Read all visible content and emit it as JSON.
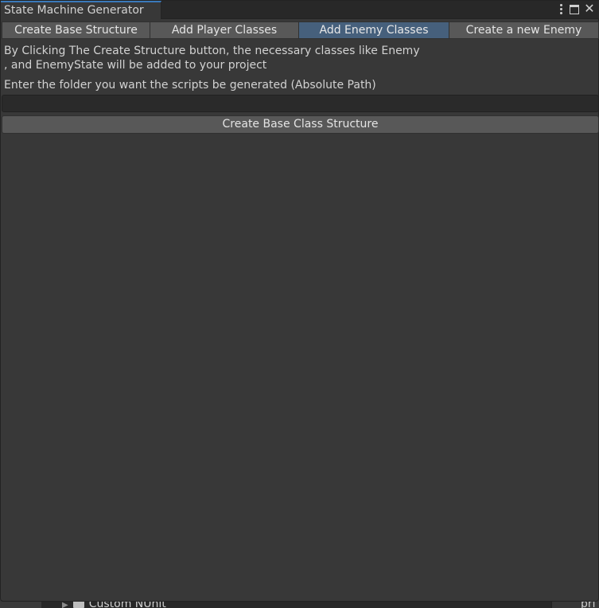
{
  "window": {
    "title": "State Machine Generator",
    "controls": {
      "menu_icon": "kebab-menu-icon",
      "maximize_icon": "maximize-icon",
      "close_icon": "close-icon",
      "close_glyph": "✕"
    }
  },
  "toolbar": {
    "tabs": [
      {
        "label": "Create Base Structure",
        "active": false
      },
      {
        "label": "Add Player Classes",
        "active": false
      },
      {
        "label": "Add Enemy Classes",
        "active": true
      },
      {
        "label": "Create a new Enemy",
        "active": false
      }
    ]
  },
  "content": {
    "description_line1": "By Clicking The Create Structure button, the necessary classes like Enemy",
    "description_line2": ", and EnemyState will be added to your project",
    "folder_prompt": "Enter the folder you want the scripts be generated (Absolute Path)",
    "folder_path_value": "",
    "create_button_label": "Create Base Class Structure"
  },
  "background": {
    "project_item_label": "Custom NUnit",
    "right_panel_text": "pri"
  },
  "colors": {
    "window_bg": "#383838",
    "titlebar_bg": "#282828",
    "accent_tab_border": "#3a79bb",
    "button_bg": "#585858",
    "active_tab_bg": "#46607c",
    "input_bg": "#2a2a2a",
    "text": "#d2d2d2"
  }
}
